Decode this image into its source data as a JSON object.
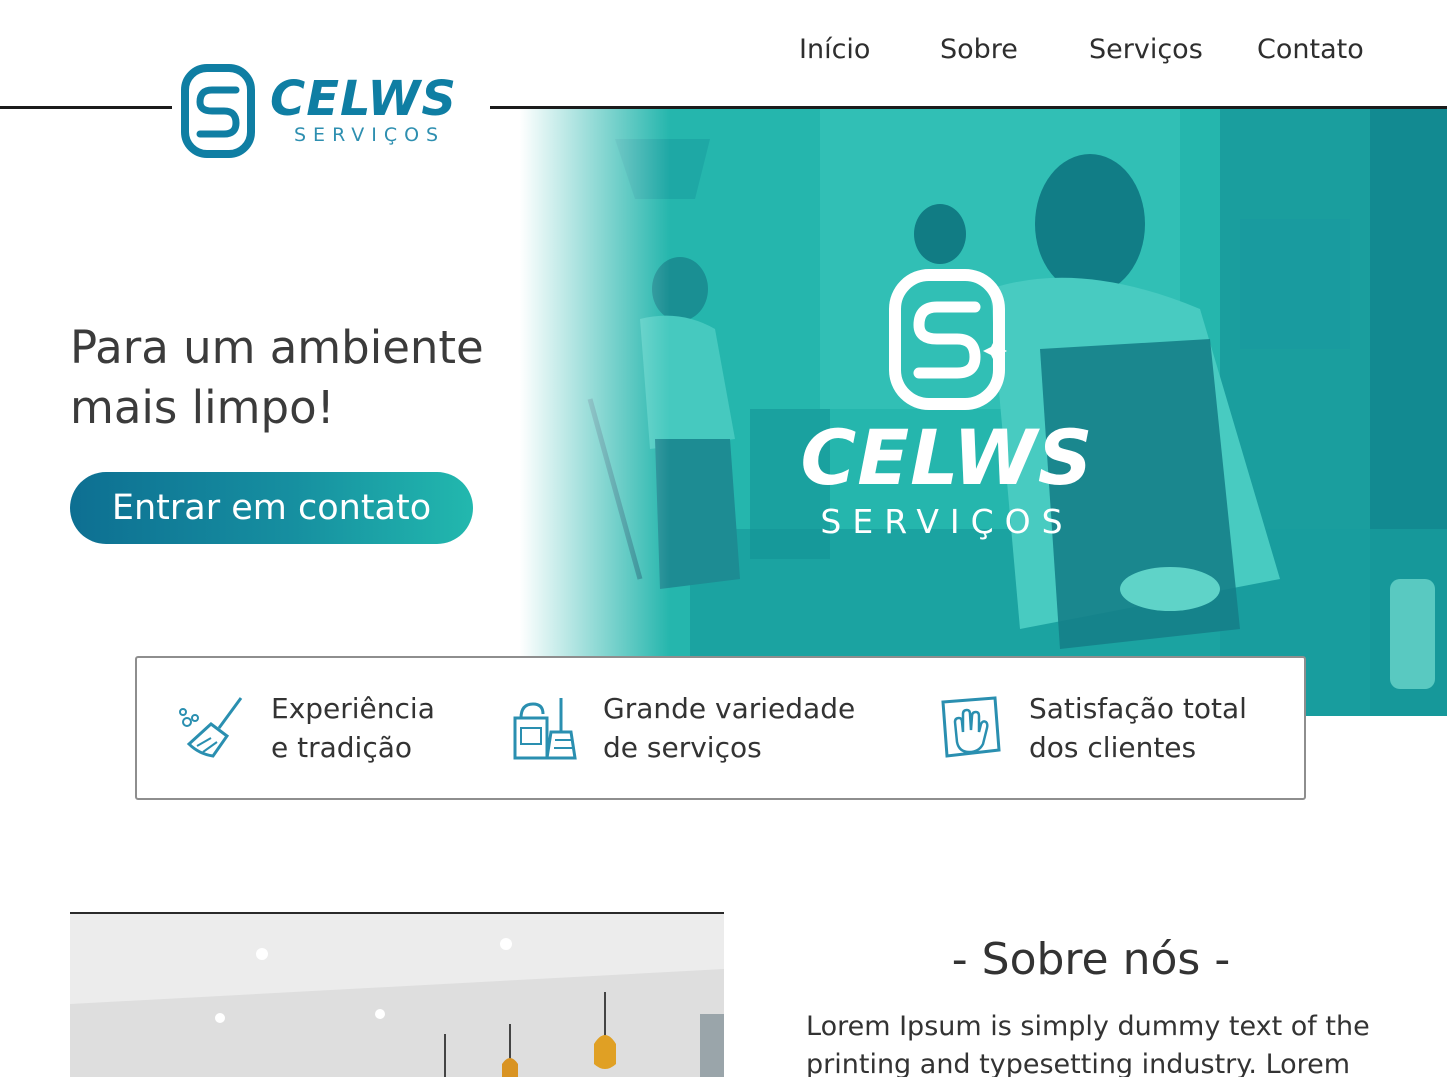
{
  "brand": {
    "name": "CELWS",
    "subtitle": "SERVIÇOS"
  },
  "nav": {
    "items": [
      {
        "label": "Início"
      },
      {
        "label": "Sobre"
      },
      {
        "label": "Serviços"
      },
      {
        "label": "Contato"
      }
    ]
  },
  "hero": {
    "title": "Para um ambiente mais limpo!",
    "cta_label": "Entrar em contato",
    "brand_name": "CELWS",
    "brand_subtitle": "SERVIÇOS"
  },
  "features": [
    {
      "icon": "broom-icon",
      "text": "Experiência\ne tradição"
    },
    {
      "icon": "cleaning-supplies-icon",
      "text": "Grande variedade\nde serviços"
    },
    {
      "icon": "hand-wipe-icon",
      "text": "Satisfação total\ndos clientes"
    }
  ],
  "about": {
    "title": "- Sobre nós -",
    "body": "Lorem Ipsum is simply dummy text of the printing and typesetting industry. Lorem"
  },
  "colors": {
    "brand_blue": "#0f7ea3",
    "brand_teal": "#22b8ae",
    "hero_overlay": "#1eb0a8"
  }
}
